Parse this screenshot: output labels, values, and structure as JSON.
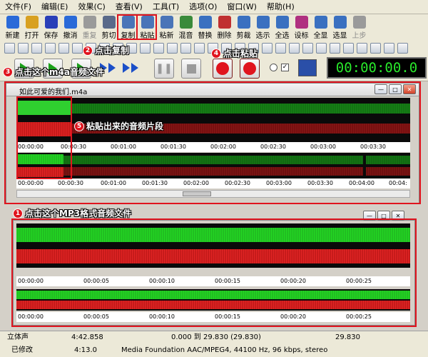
{
  "menu": [
    "文件(F)",
    "编辑(E)",
    "效果(C)",
    "查看(V)",
    "工具(T)",
    "选项(O)",
    "窗口(W)",
    "帮助(H)"
  ],
  "toolbar1": [
    {
      "label": "新建",
      "color": "#2a6ad8",
      "dim": false
    },
    {
      "label": "打开",
      "color": "#d8a020",
      "dim": false
    },
    {
      "label": "保存",
      "color": "#2a3fb8",
      "dim": false
    },
    {
      "label": "撤消",
      "color": "#2a6ad8",
      "dim": false
    },
    {
      "label": "重复",
      "color": "#9a9a9a",
      "dim": true
    },
    {
      "label": "剪切",
      "color": "#5a6a8a",
      "dim": false
    },
    {
      "label": "复制",
      "color": "#4a74b8",
      "dim": false
    },
    {
      "label": "粘贴",
      "color": "#4a74b8",
      "dim": false
    },
    {
      "label": "粘新",
      "color": "#4a74b8",
      "dim": false
    },
    {
      "label": "混音",
      "color": "#3a8a3a",
      "dim": false
    },
    {
      "label": "替换",
      "color": "#3a70c0",
      "dim": false
    },
    {
      "label": "删除",
      "color": "#c03030",
      "dim": false
    },
    {
      "label": "剪裁",
      "color": "#3a70c0",
      "dim": false
    },
    {
      "label": "选示",
      "color": "#3a70c0",
      "dim": false
    },
    {
      "label": "全选",
      "color": "#3a70c0",
      "dim": false
    },
    {
      "label": "设标",
      "color": "#b03080",
      "dim": false
    },
    {
      "label": "全显",
      "color": "#3a70c0",
      "dim": false
    },
    {
      "label": "选显",
      "color": "#3a70c0",
      "dim": false
    },
    {
      "label": "上步",
      "color": "#9a9a9a",
      "dim": true
    }
  ],
  "callouts": {
    "c1": {
      "num": "1",
      "text": "点击这个MP3格式音频文件"
    },
    "c2": {
      "num": "2",
      "text": "点击复制"
    },
    "c3": {
      "num": "3",
      "text": "点击这个m4a音频文件"
    },
    "c4": {
      "num": "4",
      "text": "点击粘贴"
    },
    "c5": {
      "num": "5",
      "text": "粘贴出来的音频片段"
    }
  },
  "timer": "00:00:00.0",
  "window1": {
    "title": "如此可爱的我们.m4a",
    "ruler_top": [
      "00:00:00",
      "00:00:30",
      "00:01:00",
      "00:01:30",
      "00:02:00",
      "00:02:30",
      "00:03:00",
      "00:03:30"
    ],
    "ruler_overview": [
      "00:00:00",
      "00:00:30",
      "00:01:00",
      "00:01:30",
      "00:02:00",
      "00:02:30",
      "00:03:00",
      "00:03:30",
      "00:04:00",
      "00:04:"
    ]
  },
  "window2": {
    "ruler_top": [
      "00:00:00",
      "00:00:05",
      "00:00:10",
      "00:00:15",
      "00:00:20",
      "00:00:25"
    ],
    "ruler_overview": [
      "00:00:00",
      "00:00:05",
      "00:00:10",
      "00:00:15",
      "00:00:20",
      "00:00:25"
    ]
  },
  "status": {
    "channel": "立体声",
    "duration": "4:42.858",
    "selection": "0.000 到 29.830 (29.830)",
    "sel_len": "29.830",
    "modified": "已修改",
    "duration2": "4:13.0",
    "format": "Media Foundation AAC/MPEG4, 44100 Hz, 96 kbps, stereo"
  }
}
